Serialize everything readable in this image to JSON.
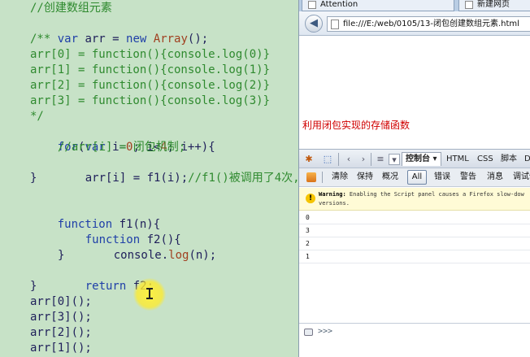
{
  "editor": {
    "lines": [
      {
        "t": "//创建数组元素",
        "c": "cm"
      },
      {
        "t": "var arr = new Array();"
      },
      {
        "t": "/**",
        "c": "cm"
      },
      {
        "t": "arr[0] = function(){console.log(0)}",
        "c": "cm"
      },
      {
        "t": "arr[1] = function(){console.log(1)}",
        "c": "cm"
      },
      {
        "t": "arr[2] = function(){console.log(2)}",
        "c": "cm"
      },
      {
        "t": "arr[3] = function(){console.log(3)}",
        "c": "cm"
      },
      {
        "t": "*/",
        "c": "cm"
      },
      {
        "t": "for(var i=0; i<4; i++){"
      },
      {
        "t": "//arr[i] = 闭包机制;",
        "c": "cm"
      },
      {
        "t": "arr[i] = f1(i);//f1()被调用了4次,"
      },
      {
        "t": "}"
      },
      {
        "t": ""
      },
      {
        "t": "function f1(n){"
      },
      {
        "t": "function f2(){"
      },
      {
        "t": "console.log(n);"
      },
      {
        "t": "}"
      },
      {
        "t": "return f2;"
      },
      {
        "t": "}"
      },
      {
        "t": "arr[0]();"
      },
      {
        "t": "arr[3]();"
      },
      {
        "t": "arr[2]();"
      },
      {
        "t": "arr[1]();"
      }
    ]
  },
  "browser": {
    "tabs": [
      "Attention",
      "新建网页"
    ],
    "back_glyph": "◀",
    "url": "file:///E:/web/0105/13-闭包创建数组元素.html",
    "page_heading": "利用闭包实现的存储函数"
  },
  "firebug": {
    "tabs": {
      "console": "控制台 ▾",
      "html": "HTML",
      "css": "CSS",
      "script": "脚本",
      "debug": "D"
    },
    "filters": {
      "clear": "清除",
      "persist": "保持",
      "profile": "概况",
      "all": "All",
      "errors": "错误",
      "warnings": "警告",
      "info": "消息",
      "debug": "调试信"
    },
    "warning_label": "Warning:",
    "warning_text": " Enabling the Script panel causes a Firefox slow-dow",
    "warning_text2": "versions.",
    "log": [
      "0",
      "3",
      "2",
      "1"
    ],
    "prompt": ">>>"
  }
}
